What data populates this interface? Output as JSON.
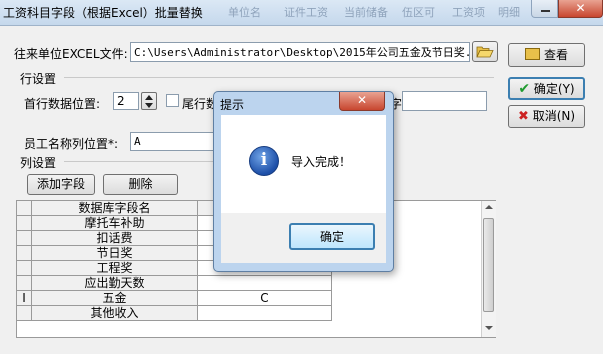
{
  "window": {
    "title": "工资科目字段（根据Excel）批量替换",
    "close_glyph": "✕",
    "background_labels": [
      "单位名",
      "证件工资",
      "当前储备",
      "伍区可",
      "工资项",
      "明细"
    ]
  },
  "file": {
    "label": "往来单位EXCEL文件:",
    "path": "C:\\Users\\Administrator\\Desktop\\2015年公司五金及节日奖.xl"
  },
  "row_settings": {
    "group_label": "行设置",
    "first_row_label": "首行数据位置:",
    "first_row_value": "2",
    "last_row_checkbox_label": "尾行数",
    "hidden_label_tail": "字"
  },
  "name_column": {
    "label": "员工名称列位置*:",
    "value": "A"
  },
  "column_settings": {
    "group_label": "列设置",
    "add_button": "添加字段",
    "delete_button": "删除"
  },
  "buttons": {
    "view": "查看",
    "ok": "确定(Y)",
    "cancel": "取消(N)"
  },
  "table": {
    "header": "数据库字段名",
    "rows": [
      {
        "marker": "",
        "name": "摩托车补助",
        "value": ""
      },
      {
        "marker": "",
        "name": "扣话费",
        "value": ""
      },
      {
        "marker": "",
        "name": "节日奖",
        "value": ""
      },
      {
        "marker": "",
        "name": "工程奖",
        "value": ""
      },
      {
        "marker": "",
        "name": "应出勤天数",
        "value": ""
      },
      {
        "marker": "I",
        "name": "五金",
        "value": "C"
      },
      {
        "marker": "",
        "name": "其他收入",
        "value": ""
      }
    ]
  },
  "dialog": {
    "title": "提示",
    "message": "导入完成！",
    "ok_button": "确定",
    "icon": "info-icon"
  }
}
